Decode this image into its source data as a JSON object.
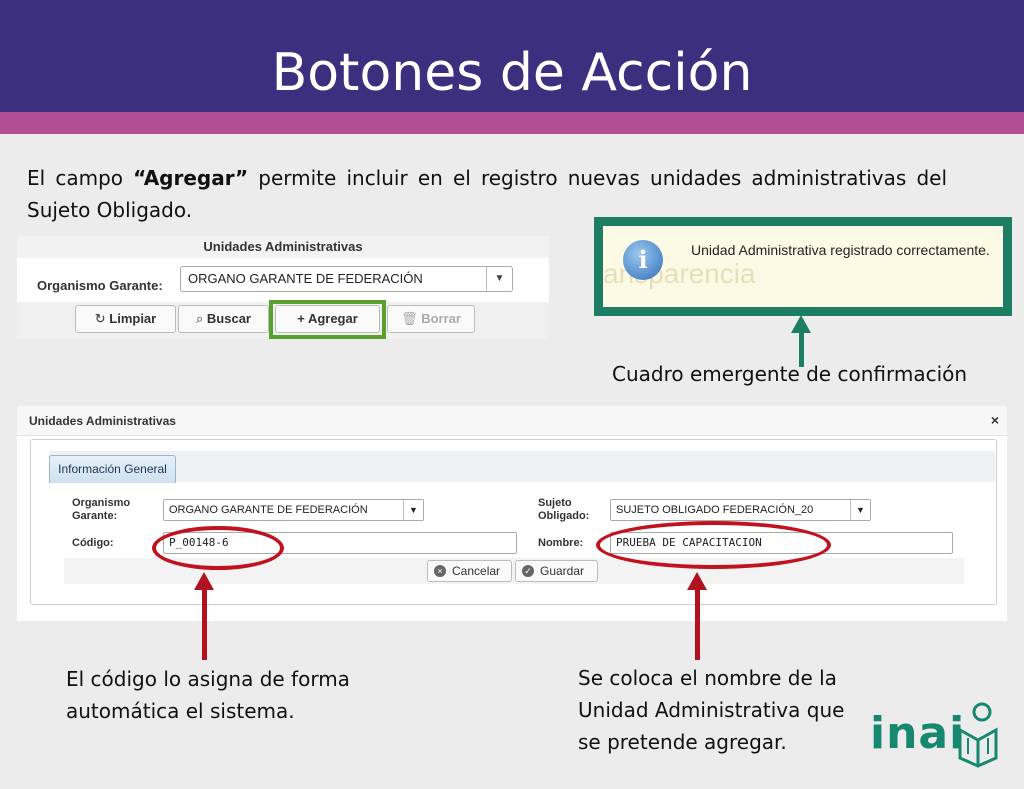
{
  "slide": {
    "title": "Botones de Acción",
    "intro_before": "El campo ",
    "intro_bold": "“Agregar”",
    "intro_after": " permite incluir en el registro nuevas unidades administrativas del Sujeto Obligado."
  },
  "form": {
    "header": "Unidades Administrativas",
    "organismo_label": "Organismo Garante:",
    "organismo_value": "ORGANO GARANTE DE FEDERACIÓN",
    "buttons": {
      "limpiar": "Limpiar",
      "buscar": "Buscar",
      "agregar": "Agregar",
      "borrar": "Borrar"
    }
  },
  "popup": {
    "message": "Unidad Administrativa registrado correctamente.",
    "background_ghost": "ansparencia",
    "caption": "Cuadro emergente de confirmación"
  },
  "modal": {
    "title": "Unidades Administrativas",
    "close": "×",
    "tab": "Información General",
    "organismo_label_1": "Organismo",
    "organismo_label_2": "Garante:",
    "organismo_value": "ORGANO GARANTE DE FEDERACIÓN",
    "sujeto_label_1": "Sujeto",
    "sujeto_label_2": "Obligado:",
    "sujeto_value": "SUJETO OBLIGADO FEDERACIÓN_20",
    "codigo_label": "Código:",
    "codigo_value": "P_00148-6",
    "nombre_label": "Nombre:",
    "nombre_value": "PRUEBA DE CAPACITACION",
    "cancel": "Cancelar",
    "save": "Guardar"
  },
  "captions": {
    "codigo_1": "El código lo asigna de forma",
    "codigo_2": "automática el sistema.",
    "nombre_1": "Se coloca el nombre de la",
    "nombre_2": "Unidad Administrativa que",
    "nombre_3": "se pretende agregar."
  },
  "logo": {
    "text": "inai"
  },
  "colors": {
    "title_bar": "#3b2f7e",
    "stripe": "#b24e93",
    "highlight_green": "#5aa02c",
    "popup_border": "#1e7e63",
    "annotation_red": "#c1121f",
    "logo_teal": "#16886f"
  }
}
